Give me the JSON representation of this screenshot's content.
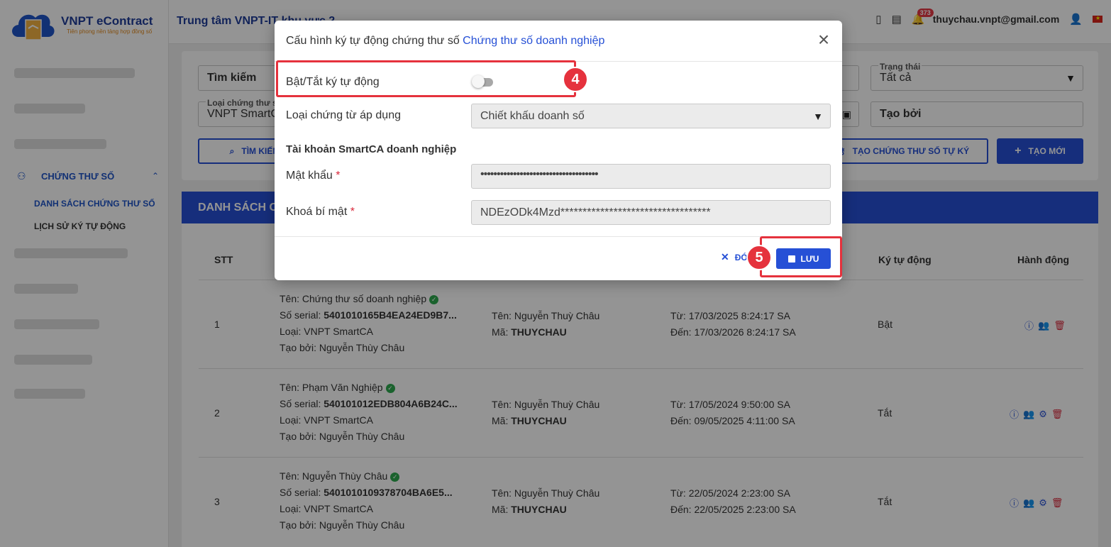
{
  "app": {
    "brand": "VNPT eContract",
    "tagline": "Tiên phong nền tảng hợp đồng số",
    "center": "Trung tâm VNPT-IT khu vực 2",
    "user_email": "thuychau.vnpt@gmail.com",
    "notification_count": "373"
  },
  "sidebar": {
    "group_label": "CHỨNG THƯ SỐ",
    "items": [
      {
        "label": "DANH SÁCH CHỨNG THƯ SỐ",
        "active": true
      },
      {
        "label": "LỊCH SỬ KÝ TỰ ĐỘNG",
        "active": false
      }
    ]
  },
  "filters": {
    "search_placeholder": "Tìm kiếm",
    "cert_type_label": "Loại chứng thư s",
    "cert_type_value": "VNPT SmartC",
    "status_label": "Trạng thái",
    "status_value": "Tất cả",
    "created_by_placeholder": "Tạo bởi",
    "search_button": "TÌM KIẾM",
    "create_auto_button": "TẠO CHỨNG THƯ SỐ TỰ KÝ",
    "create_new_button": "TẠO MỚI"
  },
  "list": {
    "title": "DANH SÁCH CH",
    "columns": {
      "stt": "STT",
      "auto_sign": "Ký tự động",
      "actions": "Hành động"
    },
    "rows": [
      {
        "stt": "1",
        "name": "Tên: Chứng thư số doanh nghiệp",
        "serial_label": "Số serial: ",
        "serial": "5401010165B4EA24ED9B7...",
        "type": "Loại: VNPT SmartCA",
        "created_by": "Tạo bởi: Nguyễn Thùy Châu",
        "owner_name": "Tên: Nguyễn Thuỳ Châu",
        "owner_code_label": "Mã: ",
        "owner_code": "THUYCHAU",
        "from": "Từ: 17/03/2025 8:24:17 SA",
        "to": "Đến: 17/03/2026 8:24:17 SA",
        "auto_sign": "Bật"
      },
      {
        "stt": "2",
        "name": "Tên: Phạm Văn Nghiệp",
        "serial_label": "Số serial: ",
        "serial": "540101012EDB804A6B24C...",
        "type": "Loại: VNPT SmartCA",
        "created_by": "Tạo bởi: Nguyễn Thùy Châu",
        "owner_name": "Tên: Nguyễn Thuỳ Châu",
        "owner_code_label": "Mã: ",
        "owner_code": "THUYCHAU",
        "from": "Từ: 17/05/2024 9:50:00 SA",
        "to": "Đến: 09/05/2025 4:11:00 SA",
        "auto_sign": "Tắt"
      },
      {
        "stt": "3",
        "name": "Tên: Nguyễn Thùy Châu",
        "serial_label": "Số serial: ",
        "serial": "5401010109378704BA6E5...",
        "type": "Loại: VNPT SmartCA",
        "created_by": "Tạo bởi: Nguyễn Thùy Châu",
        "owner_name": "Tên: Nguyễn Thuỳ Châu",
        "owner_code_label": "Mã: ",
        "owner_code": "THUYCHAU",
        "from": "Từ: 22/05/2024 2:23:00 SA",
        "to": "Đến: 22/05/2025 2:23:00 SA",
        "auto_sign": "Tắt"
      }
    ]
  },
  "modal": {
    "title_prefix": "Cấu hình ký tự động chứng thư số ",
    "title_highlight": "Chứng thư số doanh nghiệp",
    "toggle_label": "Bật/Tắt ký tự động",
    "toggle_on": false,
    "doc_type_label": "Loại chứng từ áp dụng",
    "doc_type_value": "Chiết khấu doanh số",
    "section_title": "Tài khoản SmartCA doanh nghiệp",
    "password_label": "Mật khẩu",
    "password_value": "••••••••••••••••••••••••••••••••••••",
    "secret_label": "Khoá bí mật",
    "secret_value": "NDEzODk4Mzd**********************************",
    "required_mark": "*",
    "close_button": "ĐÓ",
    "save_button": "LƯU"
  },
  "callouts": {
    "step4": "4",
    "step5": "5"
  },
  "colors": {
    "primary": "#2650d6",
    "callout": "#e5323d",
    "brand": "#1f3d99"
  }
}
